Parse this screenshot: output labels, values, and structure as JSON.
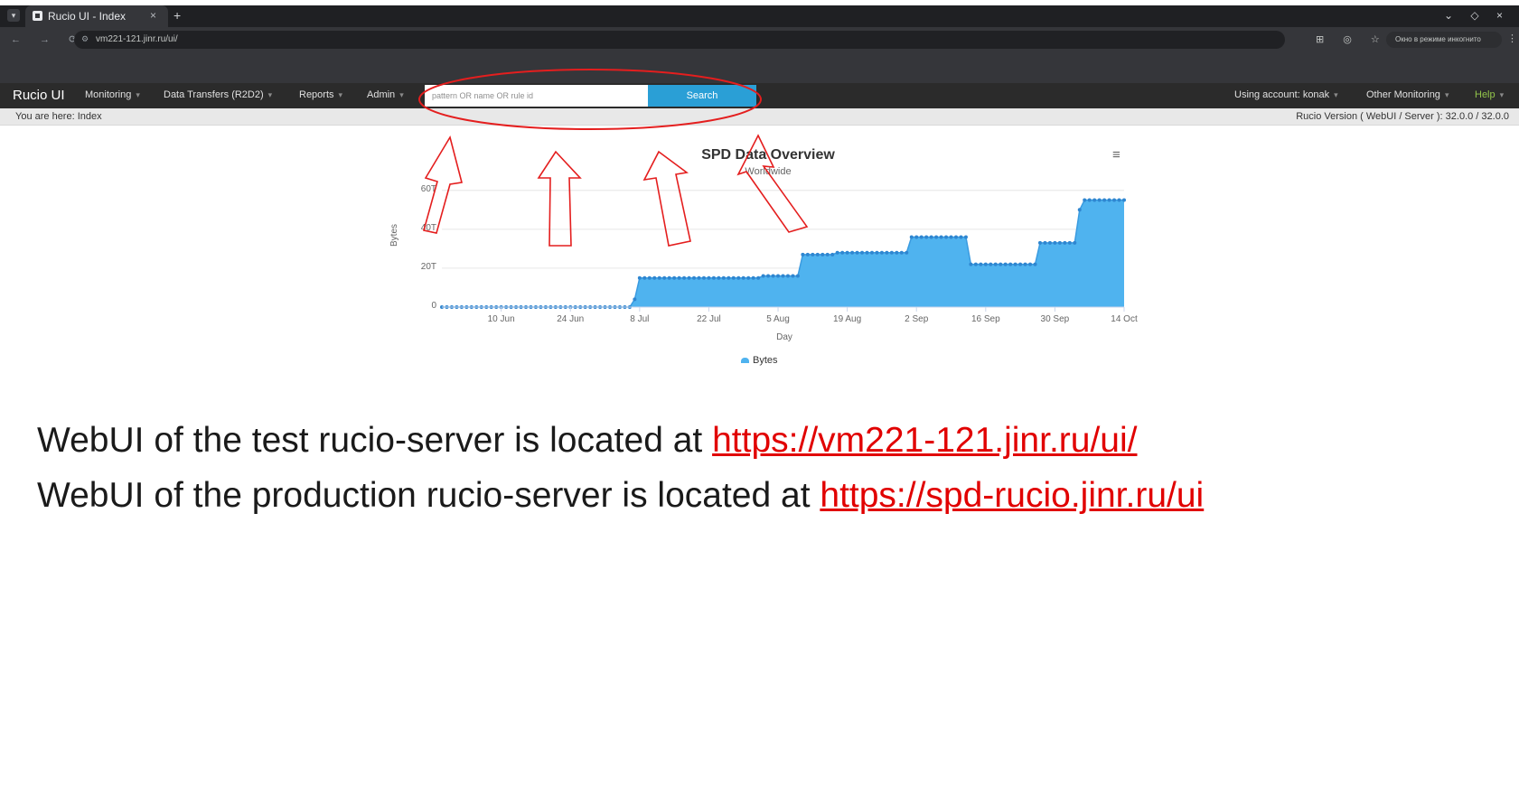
{
  "browser": {
    "tab_title": "Rucio UI - Index",
    "tab_close": "×",
    "new_tab": "+",
    "url": "vm221-121.jinr.ru/ui/",
    "incognito_label": "Окно в режиме инкогнито"
  },
  "nav": {
    "brand": "Rucio UI",
    "menu": [
      "Monitoring",
      "Data Transfers (R2D2)",
      "Reports",
      "Admin"
    ],
    "search_placeholder": "pattern OR name OR rule id",
    "search_button": "Search",
    "account": "Using account: konak",
    "other_monitoring": "Other Monitoring",
    "help": "Help"
  },
  "breadcrumb": "You are here: Index",
  "version": "Rucio Version ( WebUI / Server ): 32.0.0 / 32.0.0",
  "chart_data": {
    "type": "area",
    "title": "SPD Data Overview",
    "subtitle": "Worldwide",
    "xlabel": "Day",
    "ylabel": "Bytes",
    "x_ticks": [
      "10 Jun",
      "24 Jun",
      "8 Jul",
      "22 Jul",
      "5 Aug",
      "19 Aug",
      "2 Sep",
      "16 Sep",
      "30 Sep",
      "14 Oct"
    ],
    "y_ticks": [
      "0",
      "20T",
      "40T",
      "60T"
    ],
    "ylim": [
      0,
      65
    ],
    "series": [
      {
        "name": "Bytes",
        "color": "#4fb3ef",
        "x": [
          "29 May",
          "6 Jul",
          "7 Jul",
          "8 Jul",
          "1 Aug",
          "2 Aug",
          "9 Aug",
          "10 Aug",
          "16 Aug",
          "17 Aug",
          "31 Aug",
          "1 Sep",
          "12 Sep",
          "13 Sep",
          "26 Sep",
          "27 Sep",
          "4 Oct",
          "5 Oct",
          "6 Oct",
          "14 Oct"
        ],
        "values": [
          0,
          0,
          4,
          15,
          15,
          16,
          16,
          27,
          27,
          28,
          28,
          36,
          36,
          22,
          22,
          33,
          33,
          50,
          55,
          55
        ]
      }
    ],
    "grid": true,
    "legend_position": "bottom-center"
  },
  "slide": {
    "line1_text": "WebUI of the test rucio-server is located at ",
    "line1_link": "https://vm221-121.jinr.ru/ui/",
    "line2_text": "WebUI of the production rucio-server is located at ",
    "line2_link": "https://spd-rucio.jinr.ru/ui"
  }
}
